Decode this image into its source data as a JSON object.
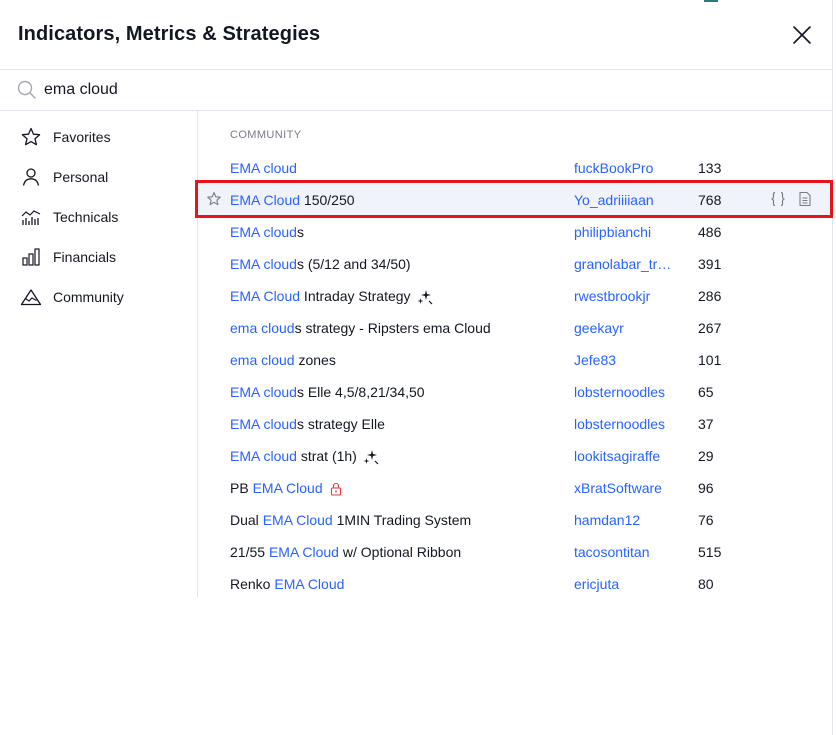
{
  "dialog": {
    "title": "Indicators, Metrics & Strategies",
    "close_label": "close"
  },
  "search": {
    "value": "ema cloud",
    "placeholder": "Search"
  },
  "sidebar": {
    "items": [
      {
        "label": "Favorites",
        "icon": "star-icon"
      },
      {
        "label": "Personal",
        "icon": "user-icon"
      },
      {
        "label": "Technicals",
        "icon": "technicals-chart-icon"
      },
      {
        "label": "Financials",
        "icon": "bar-chart-icon"
      },
      {
        "label": "Community",
        "icon": "community-mountain-icon"
      }
    ]
  },
  "main": {
    "section_title": "COMMUNITY",
    "rows": [
      {
        "pre": "",
        "match": "EMA cloud",
        "post": "",
        "author": "fuckBookPro",
        "likes": "133"
      },
      {
        "pre": "",
        "match": "EMA Cloud",
        "post": " 150/250",
        "author": "Yo_adriiiiaan",
        "likes": "768"
      },
      {
        "pre": "",
        "match": "EMA cloud",
        "post": "s",
        "author": "philipbianchi",
        "likes": "486"
      },
      {
        "pre": "",
        "match": "EMA cloud",
        "post": "s (5/12 and 34/50)",
        "author": "granolabar_trader",
        "likes": "391"
      },
      {
        "pre": "",
        "match": "EMA Cloud",
        "post": " Intraday Strategy",
        "author": "rwestbrookjr",
        "likes": "286"
      },
      {
        "pre": "",
        "match": "ema cloud",
        "post": "s strategy - Ripsters ema Cloud",
        "author": "geekayr",
        "likes": "267"
      },
      {
        "pre": "",
        "match": "ema cloud",
        "post": " zones",
        "author": "Jefe83",
        "likes": "101"
      },
      {
        "pre": "",
        "match": "EMA cloud",
        "post": "s Elle 4,5/8,21/34,50",
        "author": "lobsternoodles",
        "likes": "65"
      },
      {
        "pre": "",
        "match": "EMA cloud",
        "post": "s strategy Elle",
        "author": "lobsternoodles",
        "likes": "37"
      },
      {
        "pre": "",
        "match": "EMA cloud",
        "post": " strat (1h)",
        "author": "lookitsagiraffe",
        "likes": "29"
      },
      {
        "pre": "PB ",
        "match": "EMA Cloud",
        "post": "",
        "author": "xBratSoftware",
        "likes": "96"
      },
      {
        "pre": "Dual ",
        "match": "EMA Cloud",
        "post": " 1MIN Trading System",
        "author": "hamdan12",
        "likes": "76"
      },
      {
        "pre": "21/55 ",
        "match": "EMA Cloud",
        "post": " w/ Optional Ribbon",
        "author": "tacosontitan",
        "likes": "515"
      },
      {
        "pre": "Renko ",
        "match": "EMA Cloud",
        "post": "",
        "author": "ericjuta",
        "likes": "80"
      }
    ]
  },
  "colors": {
    "accent": "#2962ff",
    "highlight_row": "#f0f3fa",
    "annotation_box": "#e8141c",
    "lock": "#f23645"
  }
}
